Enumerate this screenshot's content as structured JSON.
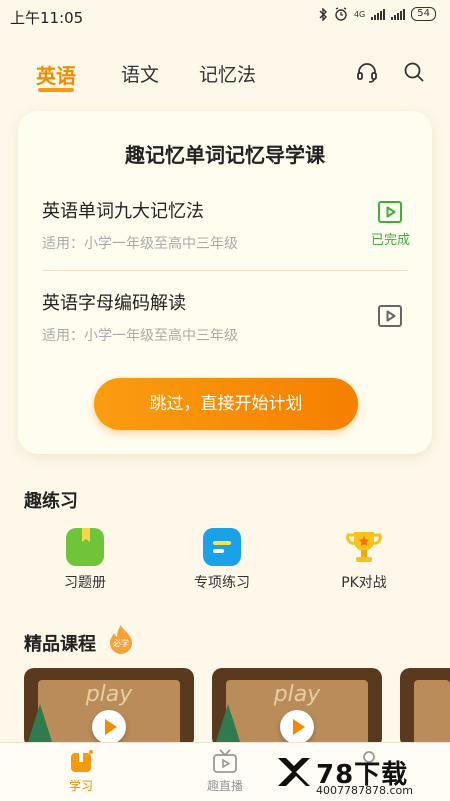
{
  "status_bar": {
    "time": "上午11:05",
    "network": "4G",
    "battery": "54"
  },
  "nav": {
    "tabs": [
      {
        "label": "英语",
        "active": true
      },
      {
        "label": "语文",
        "active": false
      },
      {
        "label": "记忆法",
        "active": false
      }
    ],
    "icons": [
      "headset-icon",
      "search-icon"
    ]
  },
  "guide": {
    "title": "趣记忆单词记忆导学课",
    "lessons": [
      {
        "title": "英语单词九大记忆法",
        "subtitle": "适用：小学一年级至高中三年级",
        "status": "已完成"
      },
      {
        "title": "英语字母编码解读",
        "subtitle": "适用：小学一年级至高中三年级",
        "status": ""
      }
    ],
    "cta": "跳过，直接开始计划"
  },
  "practice": {
    "title": "趣练习",
    "items": [
      {
        "label": "习题册",
        "icon": "workbook-icon",
        "color": "#6fc53a"
      },
      {
        "label": "专项练习",
        "icon": "special-practice-icon",
        "color": "#1aa2e8"
      },
      {
        "label": "PK对战",
        "icon": "trophy-icon",
        "color": "#f7c21a"
      }
    ]
  },
  "courses": {
    "title": "精品课程",
    "badge": "必学",
    "cards": [
      {
        "word": "play"
      },
      {
        "word": "play"
      }
    ]
  },
  "bottom_nav": [
    {
      "label": "学习",
      "active": true
    },
    {
      "label": "趣直播",
      "active": false
    },
    {
      "label": "",
      "active": false
    }
  ],
  "watermark": {
    "name": "78下载",
    "url": "4007787878.com"
  },
  "colors": {
    "accent": "#f59a0e",
    "completed": "#3fae3a",
    "background": "#fdf8ea"
  }
}
